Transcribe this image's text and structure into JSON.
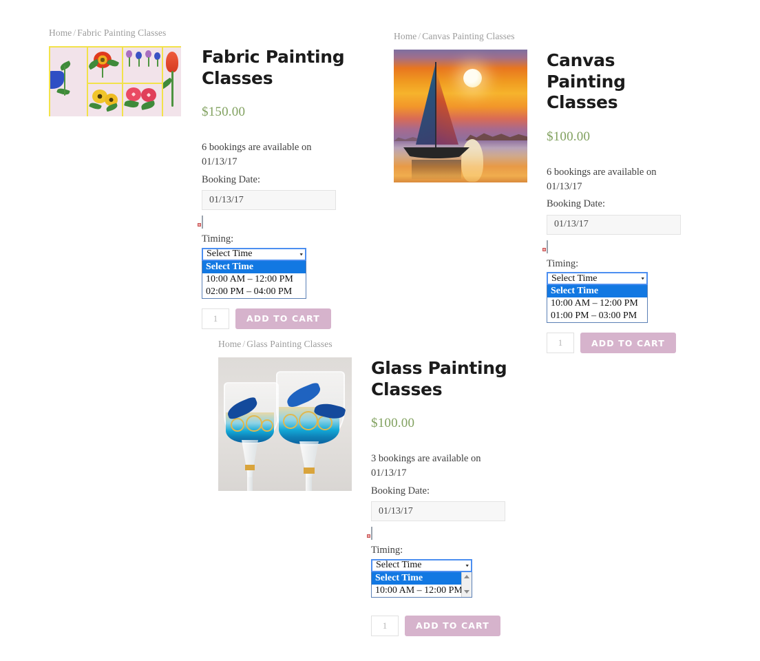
{
  "page": {
    "home_label": "Home",
    "separator": "/",
    "qty_value": "1",
    "add_to_cart_label": "ADD TO CART",
    "booking_date_label": "Booking Date:",
    "timing_label": "Timing:",
    "select_time_label": "Select Time",
    "calendar_icon": "calendar-icon",
    "dropdown_arrow": "▾",
    "colors": {
      "price": "#81a15f",
      "breadcrumb": "#9b9b9b",
      "add_to_cart_bg": "#d6b3cc",
      "select_focus_border": "#4c8ef0",
      "option_highlight": "#1278e2"
    }
  },
  "products": [
    {
      "breadcrumb_current": "Fabric Painting Classes",
      "title": "Fabric Painting Classes",
      "price": "$150.00",
      "availability": "6 bookings are available on 01/13/17",
      "booking_date_value": "01/13/17",
      "selected_time": "Select Time",
      "time_options": [
        "Select Time",
        "10:00 AM – 12:00 PM",
        "02:00 PM – 04:00 PM"
      ],
      "image_alt": "fabric-painting-flowers-collage"
    },
    {
      "breadcrumb_current": "Canvas Painting Classes",
      "title": "Canvas Painting Classes",
      "price": "$100.00",
      "availability": "6 bookings are available on 01/13/17",
      "booking_date_value": "01/13/17",
      "selected_time": "Select Time",
      "time_options": [
        "Select Time",
        "10:00 AM – 12:00 PM",
        "01:00 PM – 03:00 PM"
      ],
      "image_alt": "canvas-painting-sailboat-sunset"
    },
    {
      "breadcrumb_current": "Glass Painting Classes",
      "title": "Glass Painting Classes",
      "price": "$100.00",
      "availability": "3 bookings are available on 01/13/17",
      "booking_date_value": "01/13/17",
      "selected_time": "Select Time",
      "time_options": [
        "Select Time",
        "10:00 AM – 12:00 PM"
      ],
      "image_alt": "glass-painting-dolphin-wine-glasses",
      "dropdown_scrollable": true
    }
  ]
}
